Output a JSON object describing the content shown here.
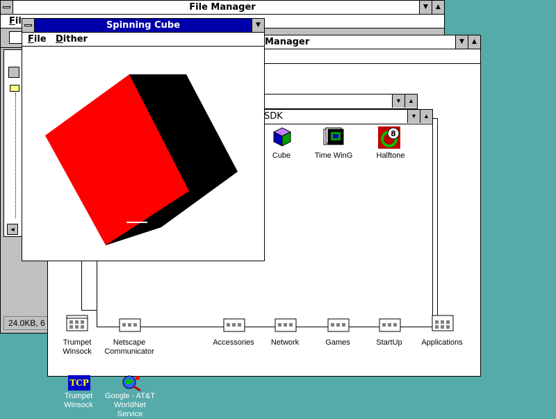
{
  "file_manager": {
    "title": "File Manager",
    "menu_first": "File",
    "status": "24.0KB, 6"
  },
  "program_manager": {
    "title_fragment": "Manager"
  },
  "sdk_group": {
    "title": "SDK",
    "icons": [
      {
        "label": "Cube",
        "icon": "cube-icon"
      },
      {
        "label": "Time WinG",
        "icon": "time-wing-icon"
      },
      {
        "label": "Halftone",
        "icon": "halftone-icon"
      }
    ]
  },
  "spinning_cube": {
    "title": "Spinning Cube",
    "menu": [
      "File",
      "Dither"
    ],
    "colors": {
      "front": "#ff0000",
      "side": "#000000"
    }
  },
  "program_groups": [
    {
      "label": "Trumpet\nWinsock"
    },
    {
      "label": "Netscape\nCommunicator"
    },
    {
      "label": "Accessories"
    },
    {
      "label": "Network"
    },
    {
      "label": "Games"
    },
    {
      "label": "StartUp"
    },
    {
      "label": "Applications"
    }
  ],
  "desktop_icons": [
    {
      "label": "Trumpet\nWinsock",
      "badge": "TCP",
      "icon": "trumpet-winsock-icon"
    },
    {
      "label": "Google - AT&T\nWorldNet\nService",
      "icon": "google-worldnet-icon"
    }
  ]
}
